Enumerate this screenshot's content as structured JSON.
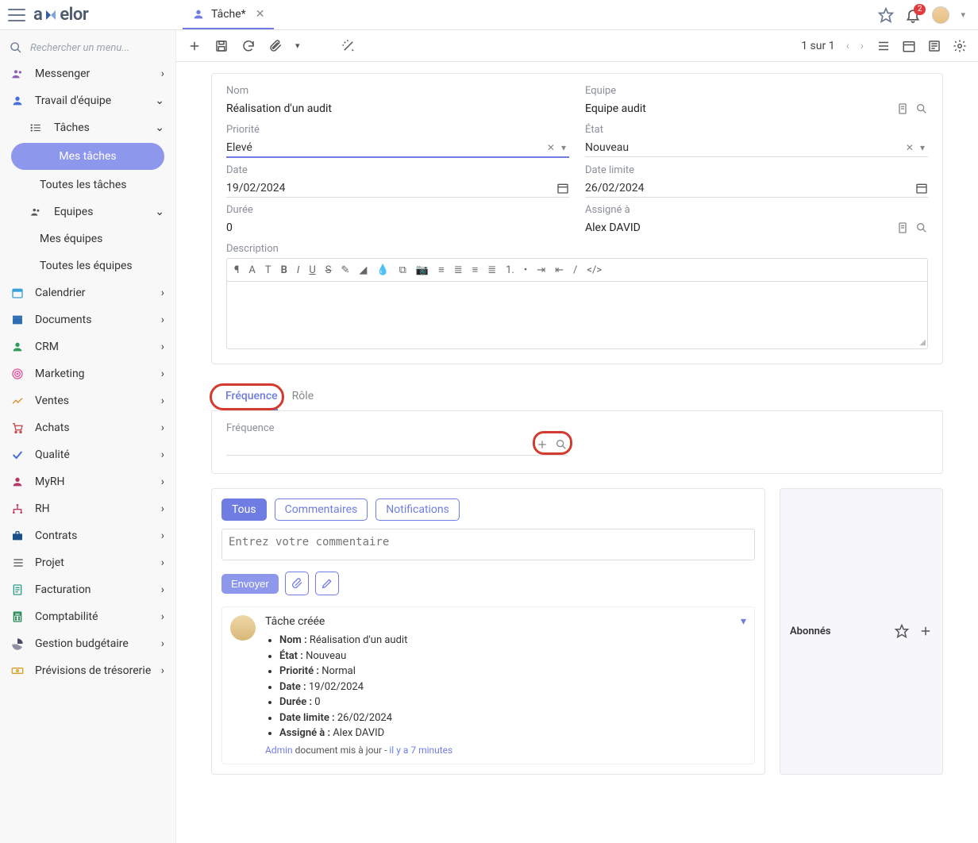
{
  "header": {
    "tab_title": "Tâche*",
    "search_placeholder": "Rechercher un menu...",
    "notification_count": "2",
    "pager_text": "1 sur 1"
  },
  "sidebar": {
    "items": [
      {
        "icon": "people",
        "label": "Messenger",
        "chev": "right",
        "color": "#8d5fb9"
      },
      {
        "icon": "person",
        "label": "Travail d'équipe",
        "chev": "down",
        "color": "#4a6fd6"
      },
      {
        "icon": "list",
        "label": "Tâches",
        "chev": "down",
        "color": "#555",
        "sub": true
      },
      {
        "icon": "people",
        "label": "Equipes",
        "chev": "down",
        "color": "#555",
        "sub2": true
      },
      {
        "icon": "cal",
        "label": "Calendrier",
        "chev": "right",
        "color": "#3aa0d8"
      },
      {
        "icon": "box",
        "label": "Documents",
        "chev": "right",
        "color": "#2f6db0"
      },
      {
        "icon": "person",
        "label": "CRM",
        "chev": "right",
        "color": "#2b9e5b"
      },
      {
        "icon": "target",
        "label": "Marketing",
        "chev": "right",
        "color": "#e256a0"
      },
      {
        "icon": "chart",
        "label": "Ventes",
        "chev": "right",
        "color": "#e08a2a"
      },
      {
        "icon": "cart",
        "label": "Achats",
        "chev": "right",
        "color": "#c94a4a"
      },
      {
        "icon": "check",
        "label": "Qualité",
        "chev": "right",
        "color": "#4a6fd6"
      },
      {
        "icon": "person",
        "label": "MyRH",
        "chev": "right",
        "color": "#b23a6b"
      },
      {
        "icon": "org",
        "label": "RH",
        "chev": "right",
        "color": "#c23a5b"
      },
      {
        "icon": "case",
        "label": "Contrats",
        "chev": "right",
        "color": "#1b4f8a"
      },
      {
        "icon": "list",
        "label": "Projet",
        "chev": "right",
        "color": "#555"
      },
      {
        "icon": "doc",
        "label": "Facturation",
        "chev": "right",
        "color": "#2fa08a"
      },
      {
        "icon": "calc",
        "label": "Comptabilité",
        "chev": "right",
        "color": "#2b8a5b"
      },
      {
        "icon": "pie",
        "label": "Gestion budgétaire",
        "chev": "right",
        "color": "#4a4a6a"
      },
      {
        "icon": "money",
        "label": "Prévisions de trésorerie",
        "chev": "right",
        "color": "#d8a02a"
      }
    ],
    "tasks_sub": {
      "active": "Mes tâches",
      "other": "Toutes les tâches"
    },
    "teams_sub": {
      "a": "Mes équipes",
      "b": "Toutes les équipes"
    }
  },
  "form": {
    "name_label": "Nom",
    "name_value": "Réalisation d'un audit",
    "team_label": "Equipe",
    "team_value": "Equipe audit",
    "priority_label": "Priorité",
    "priority_value": "Elevé",
    "state_label": "État",
    "state_value": "Nouveau",
    "date_label": "Date",
    "date_value": "19/02/2024",
    "deadline_label": "Date limite",
    "deadline_value": "26/02/2024",
    "duration_label": "Durée",
    "duration_value": "0",
    "assignee_label": "Assigné à",
    "assignee_value": "Alex DAVID",
    "description_label": "Description"
  },
  "tabs": {
    "freq": "Fréquence",
    "role": "Rôle",
    "freq_field_label": "Fréquence"
  },
  "comments": {
    "tabs": {
      "all": "Tous",
      "comments": "Commentaires",
      "notifications": "Notifications"
    },
    "placeholder": "Entrez votre commentaire",
    "send": "Envoyer",
    "followers_title": "Abonnés",
    "activity_title": "Tâche créée",
    "fields": {
      "name_l": "Nom :",
      "name_v": "Réalisation d'un audit",
      "state_l": "État :",
      "state_v": "Nouveau",
      "prio_l": "Priorité :",
      "prio_v": "Normal",
      "date_l": "Date :",
      "date_v": "19/02/2024",
      "dur_l": "Durée :",
      "dur_v": "0",
      "dl_l": "Date limite :",
      "dl_v": "26/02/2024",
      "asg_l": "Assigné à :",
      "asg_v": "Alex DAVID"
    },
    "footer_user": "Admin",
    "footer_text": "document mis à jour -",
    "footer_time": "il y a 7 minutes"
  }
}
